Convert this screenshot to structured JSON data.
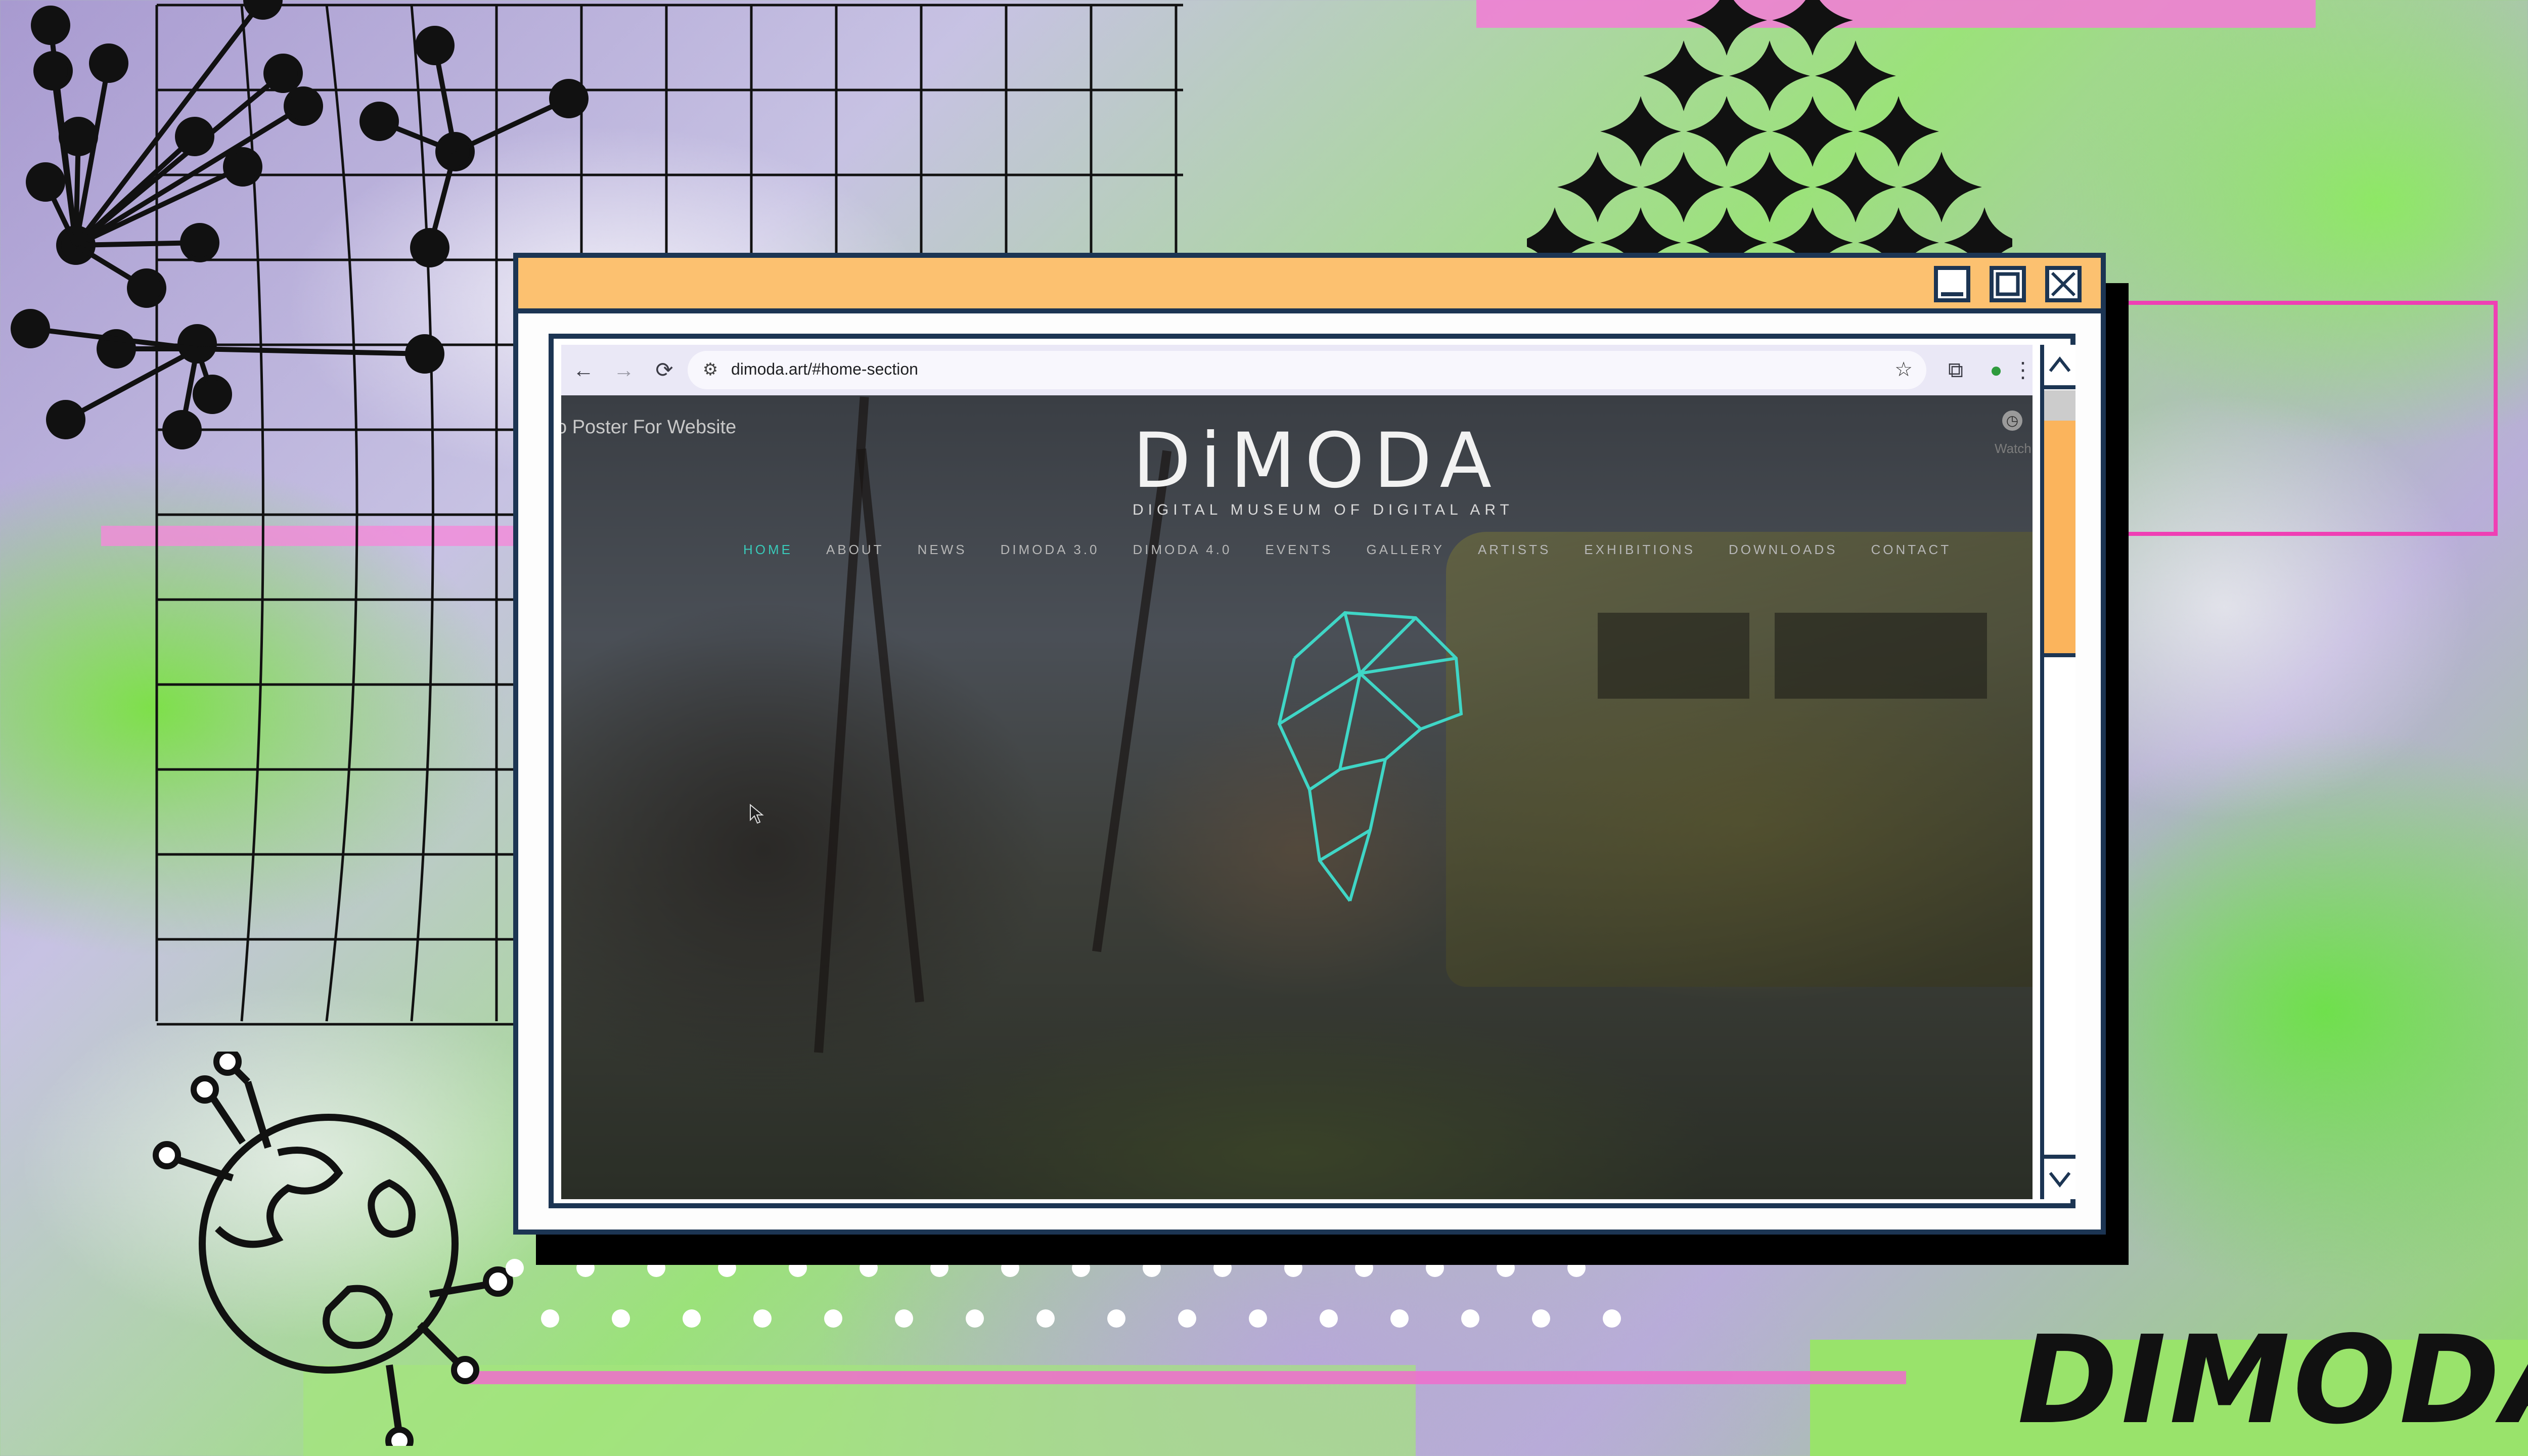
{
  "browser": {
    "url": "dimoda.art/#home-section",
    "back_icon": "←",
    "forward_icon": "→",
    "reload_icon": "⟳",
    "tune_icon": "⚙",
    "star_icon": "☆",
    "extensions_icon": "⧉",
    "profile_icon": "●",
    "menu_icon": "⋮"
  },
  "video": {
    "title": "o Poster For Website",
    "watch_later": "Watch la",
    "clock_icon": "◷"
  },
  "site": {
    "logo": "DiMODA",
    "tagline": "DIGITAL MUSEUM OF DIGITAL ART",
    "nav": [
      "HOME",
      "ABOUT",
      "NEWS",
      "DIMODA 3.0",
      "DIMODA 4.0",
      "EVENTS",
      "GALLERY",
      "ARTISTS",
      "EXHIBITIONS",
      "DOWNLOADS",
      "CONTACT"
    ],
    "active_nav": "HOME"
  },
  "brand": "DIMODA",
  "colors": {
    "title_bar": "#fcc170",
    "frame": "#1c3553",
    "accent_nav": "#39c9b8",
    "scroll_thumb": "#fbb45c"
  }
}
